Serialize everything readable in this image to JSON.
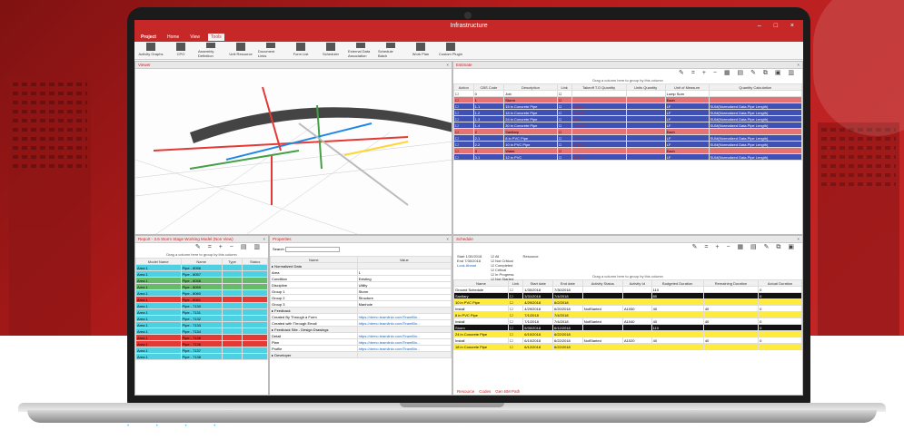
{
  "window": {
    "title": "Infrastructure",
    "controls": "– □ ×"
  },
  "ribbon_tabs": [
    {
      "label": "Project"
    },
    {
      "label": "Home"
    },
    {
      "label": "View"
    },
    {
      "label": "Tools"
    }
  ],
  "ribbon_buttons": [
    "Activity Graphs",
    "CPO",
    "Assembly Definition",
    "Unit Resource",
    "Document Links",
    "Form List",
    "Scheduler",
    "External Data Association",
    "Schedule Batch",
    "Work Plan",
    "Custom Plugin"
  ],
  "viewer": {
    "title": "Viewer"
  },
  "estimate": {
    "title": "Estimate",
    "hint": "Drag a column here to group by this column",
    "columns": [
      "Action",
      "CBS Code",
      "Description",
      "Link",
      "Takeoff T.O Quantity",
      "Units Quantity",
      "Unit of Measure",
      "Quantity Calculation"
    ],
    "rows": [
      {
        "code": "0",
        "desc": "Job",
        "uom": "Lump Sum",
        "calc": "",
        "color": ""
      },
      {
        "code": "1",
        "desc": "Storm",
        "uom": "Each",
        "calc": "",
        "color": "rR"
      },
      {
        "code": "1.1",
        "desc": "15 in Concrete Pipe",
        "qty": "426.52",
        "uom": "LF",
        "calc": "SUM(Normalized Data.Pipe Length)",
        "color": "rP"
      },
      {
        "code": "1.2",
        "desc": "18 in Concrete Pipe",
        "qty": "263.92",
        "uom": "LF",
        "calc": "SUM(Normalized Data.Pipe Length)",
        "color": "rP"
      },
      {
        "code": "1.3",
        "desc": "24 in Concrete Pipe",
        "qty": "89.1",
        "uom": "LF",
        "calc": "SUM(Normalized Data.Pipe Length)",
        "color": "rP"
      },
      {
        "code": "1.4",
        "desc": "30 in Concrete Pipe",
        "qty": "136.99",
        "uom": "LF",
        "calc": "SUM(Normalized Data.Pipe Length)",
        "color": "rP"
      },
      {
        "code": "2",
        "desc": "Sanitary",
        "uom": "Each",
        "calc": "",
        "color": "rR"
      },
      {
        "code": "2.1",
        "desc": "8 in PVC Pipe",
        "qty": "1490.16",
        "uom": "LF",
        "calc": "SUM(Normalized Data.Pipe Length)",
        "color": "rP"
      },
      {
        "code": "2.2",
        "desc": "10 in PVC Pipe",
        "qty": "471.56",
        "uom": "LF",
        "calc": "SUM(Normalized Data.Pipe Length)",
        "color": "rP"
      },
      {
        "code": "3",
        "desc": "Water",
        "uom": "Each",
        "calc": "",
        "color": "rR"
      },
      {
        "code": "3.1",
        "desc": "12 in PVC",
        "qty": "428.72",
        "uom": "LF",
        "calc": "SUM(Normalized Data.Pipe Length)",
        "color": "rP"
      }
    ]
  },
  "report": {
    "title": "Report - 3.6 Storm Stage Working Model (Non View)",
    "hint": "Drag a column here to group by this column",
    "columns": [
      "Model Name",
      "Name",
      "Type",
      "Status"
    ],
    "rows": [
      {
        "model": "Area 1",
        "name": "Pipe - 8056",
        "status": "",
        "color": "rC"
      },
      {
        "model": "Area 1",
        "name": "Pipe - 8057",
        "status": "",
        "color": "rC"
      },
      {
        "model": "Area 1",
        "name": "Pipe - 8058",
        "status": "",
        "color": "rG"
      },
      {
        "model": "Area 1",
        "name": "Pipe - 8059",
        "status": "",
        "color": "rG"
      },
      {
        "model": "Area 1",
        "name": "Pipe - 8060",
        "status": "",
        "color": "rC"
      },
      {
        "model": "Area 1",
        "name": "Pipe - 8061",
        "status": "",
        "color": "rRed"
      },
      {
        "model": "Area 1",
        "name": "Pipe - 7130",
        "status": "",
        "color": "rC"
      },
      {
        "model": "Area 1",
        "name": "Pipe - 7131",
        "status": "",
        "color": "rC"
      },
      {
        "model": "Area 1",
        "name": "Pipe - 7132",
        "status": "",
        "color": "rC"
      },
      {
        "model": "Area 1",
        "name": "Pipe - 7133",
        "status": "",
        "color": "rC"
      },
      {
        "model": "Area 1",
        "name": "Pipe - 7134",
        "status": "",
        "color": "rC"
      },
      {
        "model": "Area 1",
        "name": "Pipe - 7135",
        "status": "",
        "color": "rRed"
      },
      {
        "model": "Area 1",
        "name": "Pipe - 7136",
        "status": "",
        "color": "rRed"
      },
      {
        "model": "Area 1",
        "name": "Pipe - 7137",
        "status": "",
        "color": "rC"
      },
      {
        "model": "Area 1",
        "name": "Pipe - 7138",
        "status": "",
        "color": "rC"
      }
    ]
  },
  "properties": {
    "title": "Properties",
    "search_label": "Search",
    "columns": [
      "Name",
      "Value"
    ],
    "rows": [
      {
        "name": "Normalized Data",
        "value": "",
        "group": true
      },
      {
        "name": "Area",
        "value": "1"
      },
      {
        "name": "Condition",
        "value": "Existing"
      },
      {
        "name": "Discipline",
        "value": "Utility"
      },
      {
        "name": "Group 1",
        "value": "Storm"
      },
      {
        "name": "Group 2",
        "value": "Structure"
      },
      {
        "name": "Group 3",
        "value": "Manhole"
      },
      {
        "name": "Feedback",
        "value": "",
        "group": true
      },
      {
        "name": "Created By Through a Form",
        "value": "https://demo.teamlinkr.com/TeamBin...",
        "link": true
      },
      {
        "name": "Created with Through Email",
        "value": "https://demo.teamlinkr.com/TeamBin...",
        "link": true
      },
      {
        "name": "Feedback Site - Design Drawings",
        "value": "",
        "group": true
      },
      {
        "name": "Detail",
        "value": "https://demo.teamlinkr.com/TeamBin...",
        "link": true
      },
      {
        "name": "Plan",
        "value": "https://demo.teamlinkr.com/TeamBin...",
        "link": true
      },
      {
        "name": "Profile",
        "value": "https://demo.teamlinkr.com/TeamBin...",
        "link": true
      },
      {
        "name": "Developer",
        "value": "",
        "group": true
      }
    ]
  },
  "schedule": {
    "title": "Schedule",
    "filters": {
      "start": "1/30/2018",
      "end": "7/30/2018",
      "look_ahead": "Look Ahead",
      "status": [
        "All",
        "Not Critical",
        "Completed",
        "Critical",
        "In Progress",
        "Not Started"
      ],
      "resource": "Resource"
    },
    "hint": "Drag a column here to group by this column",
    "columns": [
      "Name",
      "Link",
      "Start date",
      "End date",
      "Activity Status",
      "Activity Id",
      "Budgeted Duration",
      "Remaining Duration",
      "Actual Duration"
    ],
    "rows": [
      {
        "name": "Ground Schedule",
        "start": "1/30/2018",
        "end": "7/30/2018",
        "status": "",
        "id": "",
        "bud": "110",
        "rem": "",
        "act": "0",
        "color": ""
      },
      {
        "name": "Sanitary",
        "start": "3/31/2018",
        "end": "7/4/2018",
        "status": "",
        "id": "",
        "bud": "80",
        "rem": "",
        "act": "0",
        "color": "rK"
      },
      {
        "name": "10 in PVC Pipe",
        "start": "4/29/2018",
        "end": "6/2/2018",
        "status": "",
        "id": "",
        "bud": "",
        "rem": "",
        "act": "",
        "color": "rY"
      },
      {
        "name": "Install",
        "start": "4/29/2018",
        "end": "6/20/2018",
        "status": "NotStarted",
        "id": "A1050",
        "bud": "40",
        "rem": "40",
        "act": "0",
        "color": ""
      },
      {
        "name": "8 in PVC Pipe",
        "start": "7/1/2018",
        "end": "7/4/2018",
        "status": "",
        "id": "",
        "bud": "",
        "rem": "",
        "act": "",
        "color": "rY"
      },
      {
        "name": "Install",
        "start": "7/1/2018",
        "end": "7/4/2018",
        "status": "NotStarted",
        "id": "A1040",
        "bud": "40",
        "rem": "40",
        "act": "0",
        "color": ""
      },
      {
        "name": "Storm",
        "start": "5/30/2018",
        "end": "6/12/2018",
        "status": "",
        "id": "",
        "bud": "110",
        "rem": "",
        "act": "0",
        "color": "rK"
      },
      {
        "name": "24 in Concrete Pipe",
        "start": "6/10/2018",
        "end": "6/22/2018",
        "status": "",
        "id": "",
        "bud": "",
        "rem": "",
        "act": "",
        "color": "rY"
      },
      {
        "name": "Install",
        "start": "6/10/2018",
        "end": "6/22/2018",
        "status": "NotStarted",
        "id": "A1020",
        "bud": "40",
        "rem": "40",
        "act": "0",
        "color": ""
      },
      {
        "name": "18 in Concrete Pipe",
        "start": "6/12/2018",
        "end": "6/22/2018",
        "status": "",
        "id": "",
        "bud": "",
        "rem": "",
        "act": "",
        "color": "rY"
      }
    ],
    "bottom_tabs": [
      "Resource",
      "Codes",
      "Gen BM Path"
    ]
  }
}
